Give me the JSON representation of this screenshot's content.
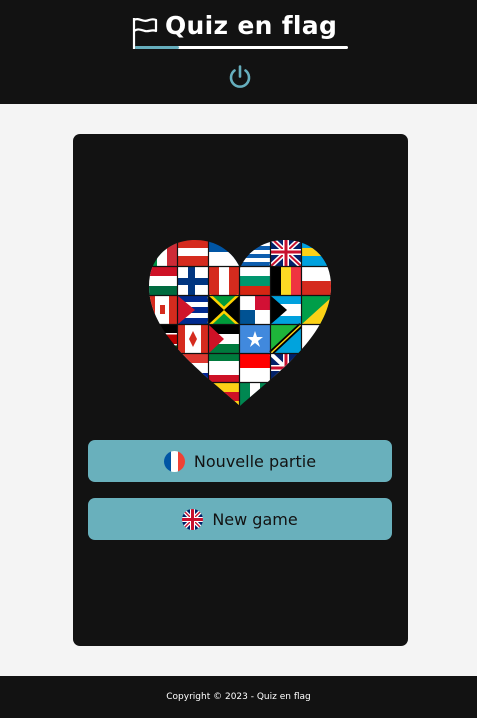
{
  "header": {
    "title": "Quiz en flag",
    "logo_icon": "flag-outline-icon",
    "power_icon": "power-icon",
    "accent_color": "#66aebd"
  },
  "main": {
    "illustration": "heart-of-world-flags",
    "buttons": [
      {
        "label": "Nouvelle partie",
        "icon": "france-flag-icon"
      },
      {
        "label": "New game",
        "icon": "uk-flag-icon"
      }
    ],
    "button_color": "#69b0bc"
  },
  "footer": {
    "copyright": "Copyright © 2023 - Quiz en flag"
  }
}
